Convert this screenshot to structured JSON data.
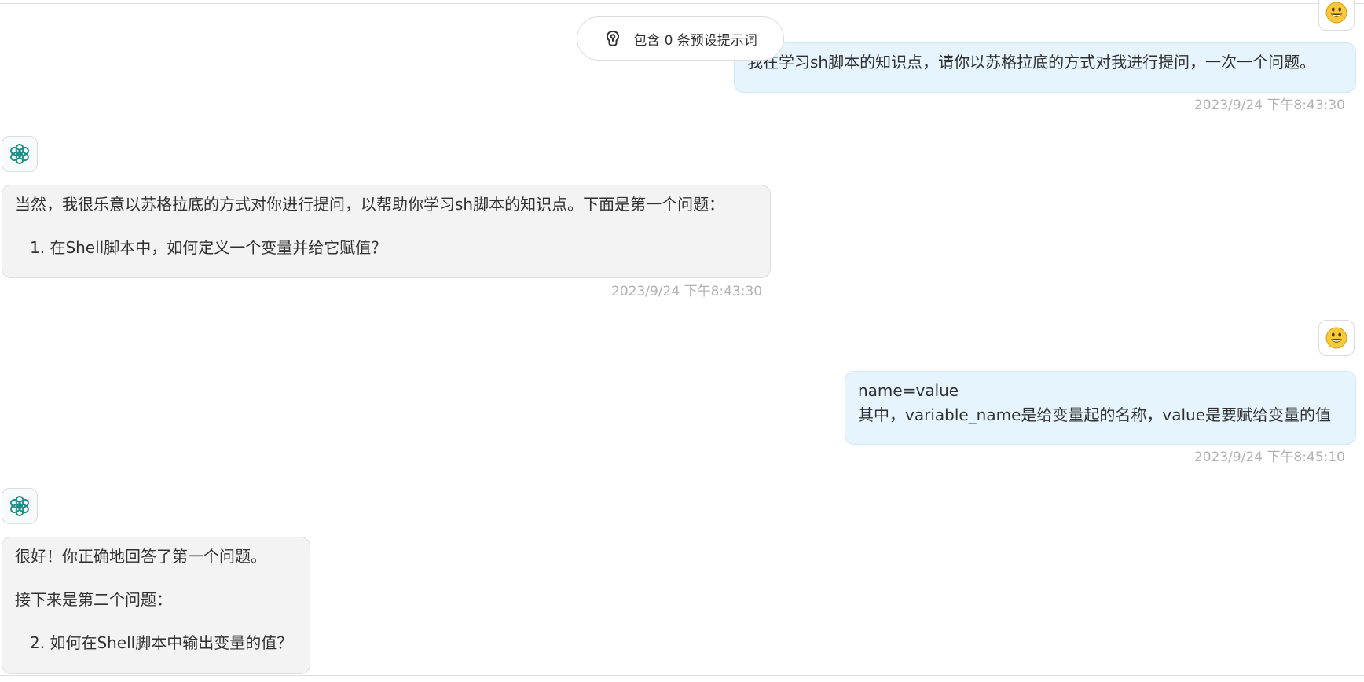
{
  "prompt_pill": {
    "label": "包含 0 条预设提示词",
    "icon": "brain-icon"
  },
  "messages": [
    {
      "role": "user",
      "avatar": "smiley-emoji-icon",
      "lines": [
        "我在学习sh脚本的知识点，请你以苏格拉底的方式对我进行提问，一次一个问题。"
      ],
      "timestamp": "2023/9/24 下午8:43:30"
    },
    {
      "role": "assistant",
      "avatar": "openai-logo-icon",
      "lines": [
        "当然，我很乐意以苏格拉底的方式对你进行提问，以帮助你学习sh脚本的知识点。下面是第一个问题：",
        "1. 在Shell脚本中，如何定义一个变量并给它赋值？"
      ],
      "timestamp": "2023/9/24 下午8:43:30"
    },
    {
      "role": "user",
      "avatar": "smiley-emoji-icon",
      "lines": [
        "name=value",
        "其中，variable_name是给变量起的名称，value是要赋给变量的值"
      ],
      "timestamp": "2023/9/24 下午8:45:10"
    },
    {
      "role": "assistant",
      "avatar": "openai-logo-icon",
      "lines": [
        "很好！你正确地回答了第一个问题。",
        "接下来是第二个问题：",
        "2. 如何在Shell脚本中输出变量的值？"
      ],
      "timestamp": ""
    }
  ],
  "colors": {
    "user_bubble": "#e6f5fd",
    "assistant_bubble": "#f3f3f3",
    "timestamp": "#b2b2b2",
    "openai_logo": "#1e8f86"
  }
}
